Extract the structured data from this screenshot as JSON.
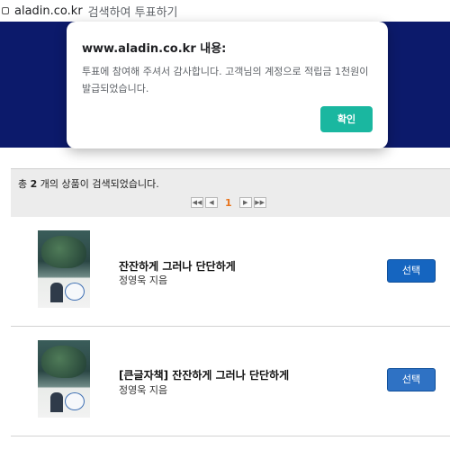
{
  "address_bar": {
    "domain": "aladin.co.kr",
    "page_title": "검색하여 투표하기"
  },
  "dialog": {
    "title": "www.aladin.co.kr 내용:",
    "message": "투표에 참여해 주셔서 감사합니다. 고객님의 계정으로 적립금 1천원이 발급되었습니다.",
    "ok_label": "확인",
    "ok_color": "#1ab7a0"
  },
  "results": {
    "count_prefix": "총 ",
    "count": "2",
    "count_suffix": " 개의 상품이 검색되었습니다.",
    "pager": {
      "first": "◀◀",
      "prev": "◀",
      "current_page": "1",
      "next": "▶",
      "last": "▶▶"
    }
  },
  "products": [
    {
      "title": "잔잔하게 그러나 단단하게",
      "author": "정영욱 지음",
      "button_label": "선택"
    },
    {
      "title": "[큰글자책] 잔잔하게 그러나 단단하게",
      "author": "정영욱 지음",
      "button_label": "선택"
    }
  ],
  "colors": {
    "banner": "#0c1a6b",
    "select_button": "#1565c0",
    "current_page": "#e8731b"
  }
}
